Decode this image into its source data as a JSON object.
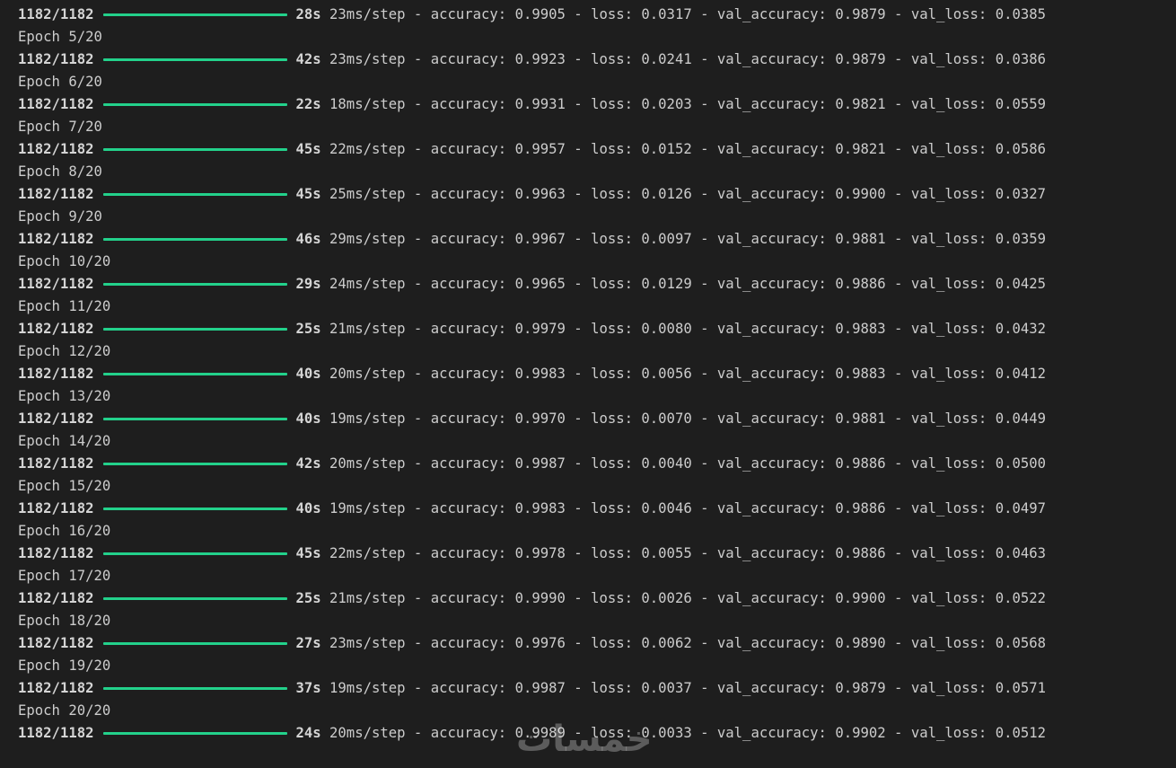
{
  "terminal": {
    "lines": [
      {
        "type": "progress",
        "steps": "1182/1182",
        "time": "28s",
        "rest": "23ms/step - accuracy: 0.9905 - loss: 0.0317 - val_accuracy: 0.9879 - val_loss: 0.0385"
      },
      {
        "type": "epoch",
        "text": "Epoch 5/20"
      },
      {
        "type": "progress",
        "steps": "1182/1182",
        "time": "42s",
        "rest": "23ms/step - accuracy: 0.9923 - loss: 0.0241 - val_accuracy: 0.9879 - val_loss: 0.0386"
      },
      {
        "type": "epoch",
        "text": "Epoch 6/20"
      },
      {
        "type": "progress",
        "steps": "1182/1182",
        "time": "22s",
        "rest": "18ms/step - accuracy: 0.9931 - loss: 0.0203 - val_accuracy: 0.9821 - val_loss: 0.0559"
      },
      {
        "type": "epoch",
        "text": "Epoch 7/20"
      },
      {
        "type": "progress",
        "steps": "1182/1182",
        "time": "45s",
        "rest": "22ms/step - accuracy: 0.9957 - loss: 0.0152 - val_accuracy: 0.9821 - val_loss: 0.0586"
      },
      {
        "type": "epoch",
        "text": "Epoch 8/20"
      },
      {
        "type": "progress",
        "steps": "1182/1182",
        "time": "45s",
        "rest": "25ms/step - accuracy: 0.9963 - loss: 0.0126 - val_accuracy: 0.9900 - val_loss: 0.0327"
      },
      {
        "type": "epoch",
        "text": "Epoch 9/20"
      },
      {
        "type": "progress",
        "steps": "1182/1182",
        "time": "46s",
        "rest": "29ms/step - accuracy: 0.9967 - loss: 0.0097 - val_accuracy: 0.9881 - val_loss: 0.0359"
      },
      {
        "type": "epoch",
        "text": "Epoch 10/20"
      },
      {
        "type": "progress",
        "steps": "1182/1182",
        "time": "29s",
        "rest": "24ms/step - accuracy: 0.9965 - loss: 0.0129 - val_accuracy: 0.9886 - val_loss: 0.0425"
      },
      {
        "type": "epoch",
        "text": "Epoch 11/20"
      },
      {
        "type": "progress",
        "steps": "1182/1182",
        "time": "25s",
        "rest": "21ms/step - accuracy: 0.9979 - loss: 0.0080 - val_accuracy: 0.9883 - val_loss: 0.0432"
      },
      {
        "type": "epoch",
        "text": "Epoch 12/20"
      },
      {
        "type": "progress",
        "steps": "1182/1182",
        "time": "40s",
        "rest": "20ms/step - accuracy: 0.9983 - loss: 0.0056 - val_accuracy: 0.9883 - val_loss: 0.0412"
      },
      {
        "type": "epoch",
        "text": "Epoch 13/20"
      },
      {
        "type": "progress",
        "steps": "1182/1182",
        "time": "40s",
        "rest": "19ms/step - accuracy: 0.9970 - loss: 0.0070 - val_accuracy: 0.9881 - val_loss: 0.0449"
      },
      {
        "type": "epoch",
        "text": "Epoch 14/20"
      },
      {
        "type": "progress",
        "steps": "1182/1182",
        "time": "42s",
        "rest": "20ms/step - accuracy: 0.9987 - loss: 0.0040 - val_accuracy: 0.9886 - val_loss: 0.0500"
      },
      {
        "type": "epoch",
        "text": "Epoch 15/20"
      },
      {
        "type": "progress",
        "steps": "1182/1182",
        "time": "40s",
        "rest": "19ms/step - accuracy: 0.9983 - loss: 0.0046 - val_accuracy: 0.9886 - val_loss: 0.0497"
      },
      {
        "type": "epoch",
        "text": "Epoch 16/20"
      },
      {
        "type": "progress",
        "steps": "1182/1182",
        "time": "45s",
        "rest": "22ms/step - accuracy: 0.9978 - loss: 0.0055 - val_accuracy: 0.9886 - val_loss: 0.0463"
      },
      {
        "type": "epoch",
        "text": "Epoch 17/20"
      },
      {
        "type": "progress",
        "steps": "1182/1182",
        "time": "25s",
        "rest": "21ms/step - accuracy: 0.9990 - loss: 0.0026 - val_accuracy: 0.9900 - val_loss: 0.0522"
      },
      {
        "type": "epoch",
        "text": "Epoch 18/20"
      },
      {
        "type": "progress",
        "steps": "1182/1182",
        "time": "27s",
        "rest": "23ms/step - accuracy: 0.9976 - loss: 0.0062 - val_accuracy: 0.9890 - val_loss: 0.0568"
      },
      {
        "type": "epoch",
        "text": "Epoch 19/20"
      },
      {
        "type": "progress",
        "steps": "1182/1182",
        "time": "37s",
        "rest": "19ms/step - accuracy: 0.9987 - loss: 0.0037 - val_accuracy: 0.9879 - val_loss: 0.0571"
      },
      {
        "type": "epoch",
        "text": "Epoch 20/20"
      },
      {
        "type": "progress",
        "steps": "1182/1182",
        "time": "24s",
        "rest": "20ms/step - accuracy: 0.9989 - loss: 0.0033 - val_accuracy: 0.9902 - val_loss: 0.0512"
      }
    ],
    "progress_fill": 1.0
  },
  "watermark": {
    "text": "خمسات"
  },
  "colors": {
    "background": "#1e1e1e",
    "text": "#cccccc",
    "progress_bar": "#23d18b"
  }
}
